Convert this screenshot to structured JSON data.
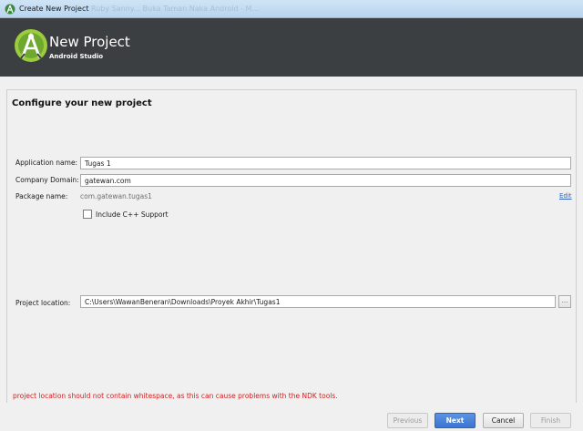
{
  "window": {
    "title": "Create New Project",
    "ghost_text": "Ruby Sanny... Buka Taman Naka Android - M..."
  },
  "header": {
    "title": "New Project",
    "subtitle": "Android Studio"
  },
  "form": {
    "section_title": "Configure your new project",
    "app_name_label": "Application name:",
    "app_name_value": "Tugas 1",
    "company_domain_label": "Company Domain:",
    "company_domain_value": "gatewan.com",
    "package_name_label": "Package name:",
    "package_name_value": "com.gatewan.tugas1",
    "edit_link": "Edit",
    "include_cpp_label": "Include C++ Support",
    "include_cpp_checked": false,
    "project_location_label": "Project location:",
    "project_location_value": "C:\\Users\\WawanBeneran\\Downloads\\Proyek Akhir\\Tugas1",
    "browse_label": "..."
  },
  "warning": "project location should not contain whitespace, as this can cause problems with the NDK tools.",
  "buttons": {
    "previous": "Previous",
    "next": "Next",
    "cancel": "Cancel",
    "finish": "Finish"
  },
  "colors": {
    "header_bg": "#3c3f41",
    "logo_green": "#9ccc3d",
    "warning": "#d21f1f",
    "primary": "#3d75cf",
    "link": "#2b62c2"
  }
}
